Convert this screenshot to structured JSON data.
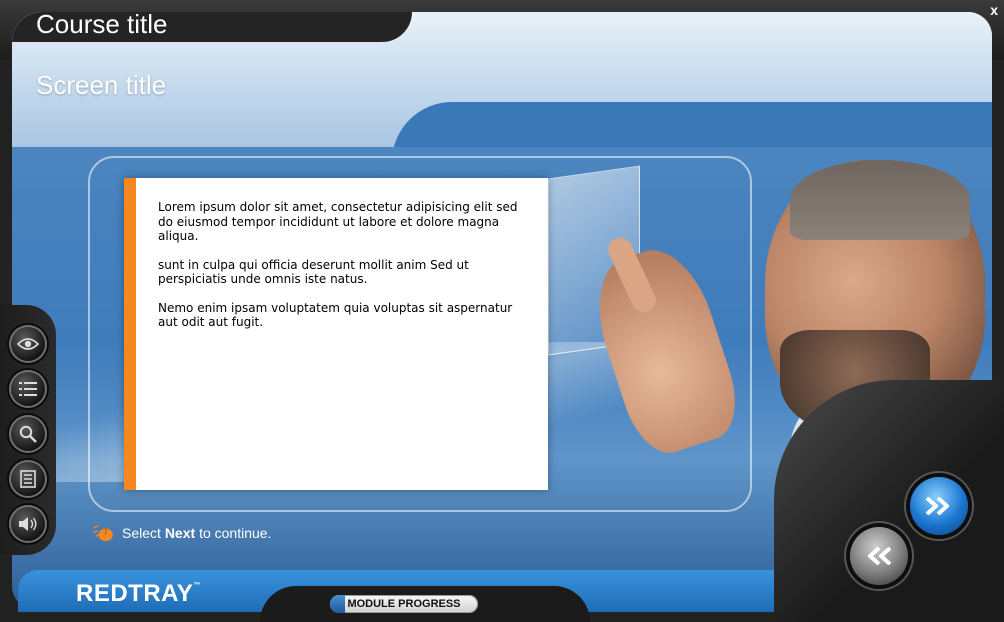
{
  "window": {
    "course_title": "Course title",
    "close_label": "x"
  },
  "screen": {
    "title": "Screen title"
  },
  "content": {
    "paragraphs": [
      "Lorem ipsum dolor sit amet, consectetur adipisicing elit sed do eiusmod tempor incididunt ut labore et dolore magna aliqua.",
      "sunt in culpa qui officia deserunt mollit anim Sed ut perspiciatis unde omnis iste natus.",
      "Nemo enim ipsam voluptatem quia voluptas sit aspernatur aut odit aut fugit."
    ]
  },
  "sidebar": {
    "buttons": [
      {
        "icon": "eye-icon"
      },
      {
        "icon": "menu-list-icon"
      },
      {
        "icon": "search-icon"
      },
      {
        "icon": "notes-icon"
      },
      {
        "icon": "audio-icon"
      }
    ]
  },
  "hint": {
    "prefix": "Select",
    "bold": "Next",
    "suffix": "to continue."
  },
  "footer": {
    "logo": "REDTRAY",
    "trademark": "™",
    "progress_label": "MODULE PROGRESS",
    "progress_fraction": 0.1
  },
  "nav": {
    "next_icon": "double-chevron-right-icon",
    "back_icon": "double-chevron-left-icon"
  },
  "colors": {
    "accent": "#f5891f",
    "brand_blue": "#2a7fcf"
  }
}
